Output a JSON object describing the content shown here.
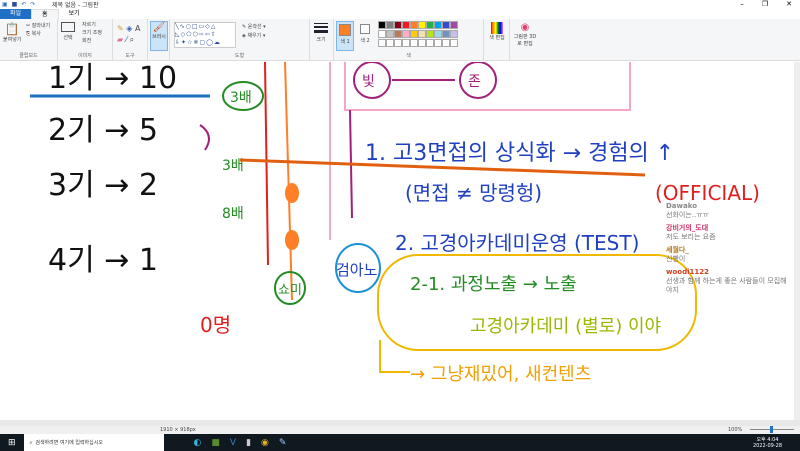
{
  "window": {
    "title": "제목 없음 - 그림판",
    "minimize": "–",
    "restore": "❐",
    "close": "✕"
  },
  "tabs": [
    "파일",
    "홈",
    "보기"
  ],
  "ribbon": {
    "clipboard": {
      "paste": "붙여넣기",
      "cut": "잘라내기",
      "copy": "복사",
      "label": "클립보드"
    },
    "image": {
      "select": "선택",
      "crop": "자르기",
      "resize": "크기 조정",
      "rotate": "회전",
      "label": "이미지"
    },
    "tools": {
      "label": "도구"
    },
    "brush": "브러시",
    "shapes": {
      "outline": "윤곽선",
      "fill": "채우기",
      "label": "도형"
    },
    "size": "크기",
    "color1": "색 1",
    "color2": "색 2",
    "edit_colors": "색 편집",
    "paint3d": "그림판 3D로 편집",
    "colors_label": "색",
    "palette": [
      "#000000",
      "#7f7f7f",
      "#880015",
      "#ed1c24",
      "#ff7f27",
      "#fff200",
      "#22b14c",
      "#00a2e8",
      "#3f48cc",
      "#a349a4",
      "#ffffff",
      "#c3c3c3",
      "#b97a57",
      "#ffaec9",
      "#ffc90e",
      "#efe4b0",
      "#b5e61d",
      "#99d9ea",
      "#7092be",
      "#c8bfe7"
    ],
    "color1_value": "#ff7f27"
  },
  "canvas": {
    "left": [
      "1기 → 10",
      "2기 → 5",
      "3기 → 2",
      "4기 → 1"
    ],
    "notes": [
      "3배",
      "3배",
      "8배",
      "0명",
      "쇼미",
      "빛",
      "존",
      "검아노"
    ],
    "items": [
      "1. 고3면접의 상식화 → 경험의 ↑",
      "(면접 ≠ 망령헝)",
      "(OFFICIAL)",
      "2. 고경아카데미운영 (TEST)",
      "2-1. 과정노출 → 노출",
      "고경아카데미 (별로) 이야",
      "→ 그냥재밌어, 새컨텐츠"
    ]
  },
  "chat": [
    {
      "user": "Dawako",
      "msg": "선화이는..ㅠㅠ",
      "color": "#888888"
    },
    {
      "user": "강비거의_도대",
      "msg": "저도 보리는 요즘",
      "color": "#d0306a"
    },
    {
      "user": "세월다_",
      "msg": "신빵이",
      "color": "#b07a20"
    },
    {
      "user": "woodi1122",
      "msg": "선생과 함께 하는게 좋은 사람들이 모집해야지",
      "color": "#d04020"
    }
  ],
  "status": {
    "size": "1910 × 918px",
    "zoom": "100%"
  },
  "taskbar": {
    "search": "검색하려면 여기에 입력하십시오",
    "time": "오후 4:04",
    "date": "2022-09-28"
  }
}
